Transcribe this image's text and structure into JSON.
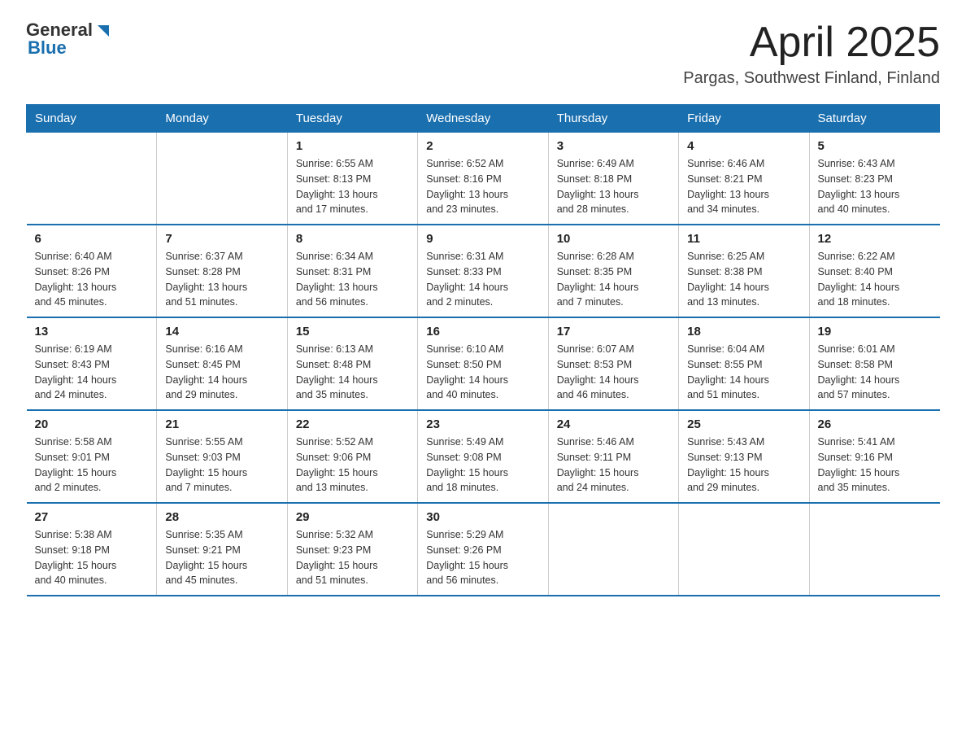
{
  "logo": {
    "text_general": "General",
    "text_blue": "Blue"
  },
  "header": {
    "month_title": "April 2025",
    "location": "Pargas, Southwest Finland, Finland"
  },
  "weekdays": [
    "Sunday",
    "Monday",
    "Tuesday",
    "Wednesday",
    "Thursday",
    "Friday",
    "Saturday"
  ],
  "weeks": [
    [
      {
        "day": "",
        "info": ""
      },
      {
        "day": "",
        "info": ""
      },
      {
        "day": "1",
        "info": "Sunrise: 6:55 AM\nSunset: 8:13 PM\nDaylight: 13 hours\nand 17 minutes."
      },
      {
        "day": "2",
        "info": "Sunrise: 6:52 AM\nSunset: 8:16 PM\nDaylight: 13 hours\nand 23 minutes."
      },
      {
        "day": "3",
        "info": "Sunrise: 6:49 AM\nSunset: 8:18 PM\nDaylight: 13 hours\nand 28 minutes."
      },
      {
        "day": "4",
        "info": "Sunrise: 6:46 AM\nSunset: 8:21 PM\nDaylight: 13 hours\nand 34 minutes."
      },
      {
        "day": "5",
        "info": "Sunrise: 6:43 AM\nSunset: 8:23 PM\nDaylight: 13 hours\nand 40 minutes."
      }
    ],
    [
      {
        "day": "6",
        "info": "Sunrise: 6:40 AM\nSunset: 8:26 PM\nDaylight: 13 hours\nand 45 minutes."
      },
      {
        "day": "7",
        "info": "Sunrise: 6:37 AM\nSunset: 8:28 PM\nDaylight: 13 hours\nand 51 minutes."
      },
      {
        "day": "8",
        "info": "Sunrise: 6:34 AM\nSunset: 8:31 PM\nDaylight: 13 hours\nand 56 minutes."
      },
      {
        "day": "9",
        "info": "Sunrise: 6:31 AM\nSunset: 8:33 PM\nDaylight: 14 hours\nand 2 minutes."
      },
      {
        "day": "10",
        "info": "Sunrise: 6:28 AM\nSunset: 8:35 PM\nDaylight: 14 hours\nand 7 minutes."
      },
      {
        "day": "11",
        "info": "Sunrise: 6:25 AM\nSunset: 8:38 PM\nDaylight: 14 hours\nand 13 minutes."
      },
      {
        "day": "12",
        "info": "Sunrise: 6:22 AM\nSunset: 8:40 PM\nDaylight: 14 hours\nand 18 minutes."
      }
    ],
    [
      {
        "day": "13",
        "info": "Sunrise: 6:19 AM\nSunset: 8:43 PM\nDaylight: 14 hours\nand 24 minutes."
      },
      {
        "day": "14",
        "info": "Sunrise: 6:16 AM\nSunset: 8:45 PM\nDaylight: 14 hours\nand 29 minutes."
      },
      {
        "day": "15",
        "info": "Sunrise: 6:13 AM\nSunset: 8:48 PM\nDaylight: 14 hours\nand 35 minutes."
      },
      {
        "day": "16",
        "info": "Sunrise: 6:10 AM\nSunset: 8:50 PM\nDaylight: 14 hours\nand 40 minutes."
      },
      {
        "day": "17",
        "info": "Sunrise: 6:07 AM\nSunset: 8:53 PM\nDaylight: 14 hours\nand 46 minutes."
      },
      {
        "day": "18",
        "info": "Sunrise: 6:04 AM\nSunset: 8:55 PM\nDaylight: 14 hours\nand 51 minutes."
      },
      {
        "day": "19",
        "info": "Sunrise: 6:01 AM\nSunset: 8:58 PM\nDaylight: 14 hours\nand 57 minutes."
      }
    ],
    [
      {
        "day": "20",
        "info": "Sunrise: 5:58 AM\nSunset: 9:01 PM\nDaylight: 15 hours\nand 2 minutes."
      },
      {
        "day": "21",
        "info": "Sunrise: 5:55 AM\nSunset: 9:03 PM\nDaylight: 15 hours\nand 7 minutes."
      },
      {
        "day": "22",
        "info": "Sunrise: 5:52 AM\nSunset: 9:06 PM\nDaylight: 15 hours\nand 13 minutes."
      },
      {
        "day": "23",
        "info": "Sunrise: 5:49 AM\nSunset: 9:08 PM\nDaylight: 15 hours\nand 18 minutes."
      },
      {
        "day": "24",
        "info": "Sunrise: 5:46 AM\nSunset: 9:11 PM\nDaylight: 15 hours\nand 24 minutes."
      },
      {
        "day": "25",
        "info": "Sunrise: 5:43 AM\nSunset: 9:13 PM\nDaylight: 15 hours\nand 29 minutes."
      },
      {
        "day": "26",
        "info": "Sunrise: 5:41 AM\nSunset: 9:16 PM\nDaylight: 15 hours\nand 35 minutes."
      }
    ],
    [
      {
        "day": "27",
        "info": "Sunrise: 5:38 AM\nSunset: 9:18 PM\nDaylight: 15 hours\nand 40 minutes."
      },
      {
        "day": "28",
        "info": "Sunrise: 5:35 AM\nSunset: 9:21 PM\nDaylight: 15 hours\nand 45 minutes."
      },
      {
        "day": "29",
        "info": "Sunrise: 5:32 AM\nSunset: 9:23 PM\nDaylight: 15 hours\nand 51 minutes."
      },
      {
        "day": "30",
        "info": "Sunrise: 5:29 AM\nSunset: 9:26 PM\nDaylight: 15 hours\nand 56 minutes."
      },
      {
        "day": "",
        "info": ""
      },
      {
        "day": "",
        "info": ""
      },
      {
        "day": "",
        "info": ""
      }
    ]
  ]
}
